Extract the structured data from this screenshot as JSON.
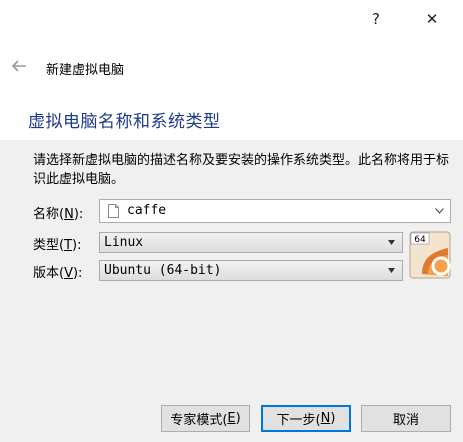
{
  "titlebar": {
    "help_label": "?",
    "close_label": "✕",
    "help_icon": "question-mark-icon",
    "close_icon": "close-icon"
  },
  "header": {
    "back_icon": "back-arrow-icon",
    "title": "新建虚拟电脑"
  },
  "section": {
    "heading": "虚拟电脑名称和系统类型"
  },
  "description": "请选择新虚拟电脑的描述名称及要安装的操作系统类型。此名称将用于标识此虚拟电脑。",
  "form": {
    "name": {
      "label_pre": "名称(",
      "mnemonic": "N",
      "label_post": "):",
      "value": "caffe",
      "icon": "file-icon"
    },
    "type": {
      "label_pre": "类型(",
      "mnemonic": "T",
      "label_post": "):",
      "value": "Linux"
    },
    "version": {
      "label_pre": "版本(",
      "mnemonic": "V",
      "label_post": "):",
      "value": "Ubuntu (64-bit)"
    },
    "os_icon": {
      "badge": "64",
      "icon": "ubuntu-64-os-icon"
    }
  },
  "buttons": {
    "expert": {
      "label_pre": "专家模式(",
      "mnemonic": "E",
      "label_post": ")"
    },
    "next": {
      "label_pre": "下一步(",
      "mnemonic": "N",
      "label_post": ")"
    },
    "cancel": {
      "label": "取消"
    }
  },
  "colors": {
    "heading": "#1e3a8a",
    "panel_bg": "#f0f0f0",
    "default_button_border": "#0078d7"
  }
}
